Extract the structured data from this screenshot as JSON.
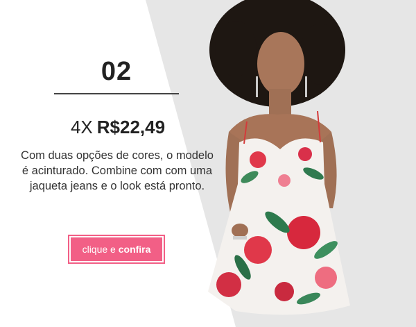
{
  "item": {
    "number": "02",
    "installments": "4X",
    "price": "R$22,49",
    "description": "Com duas opções de cores, o modelo é acinturado. Combine com com uma jaqueta jeans e o look está pronto.",
    "cta": {
      "prefix": "clique e",
      "bold": "confira"
    }
  },
  "colors": {
    "accent": "#f25f86",
    "background_photo": "#e7e7e7"
  },
  "images": {
    "model": "model-in-floral-dress-photo"
  }
}
